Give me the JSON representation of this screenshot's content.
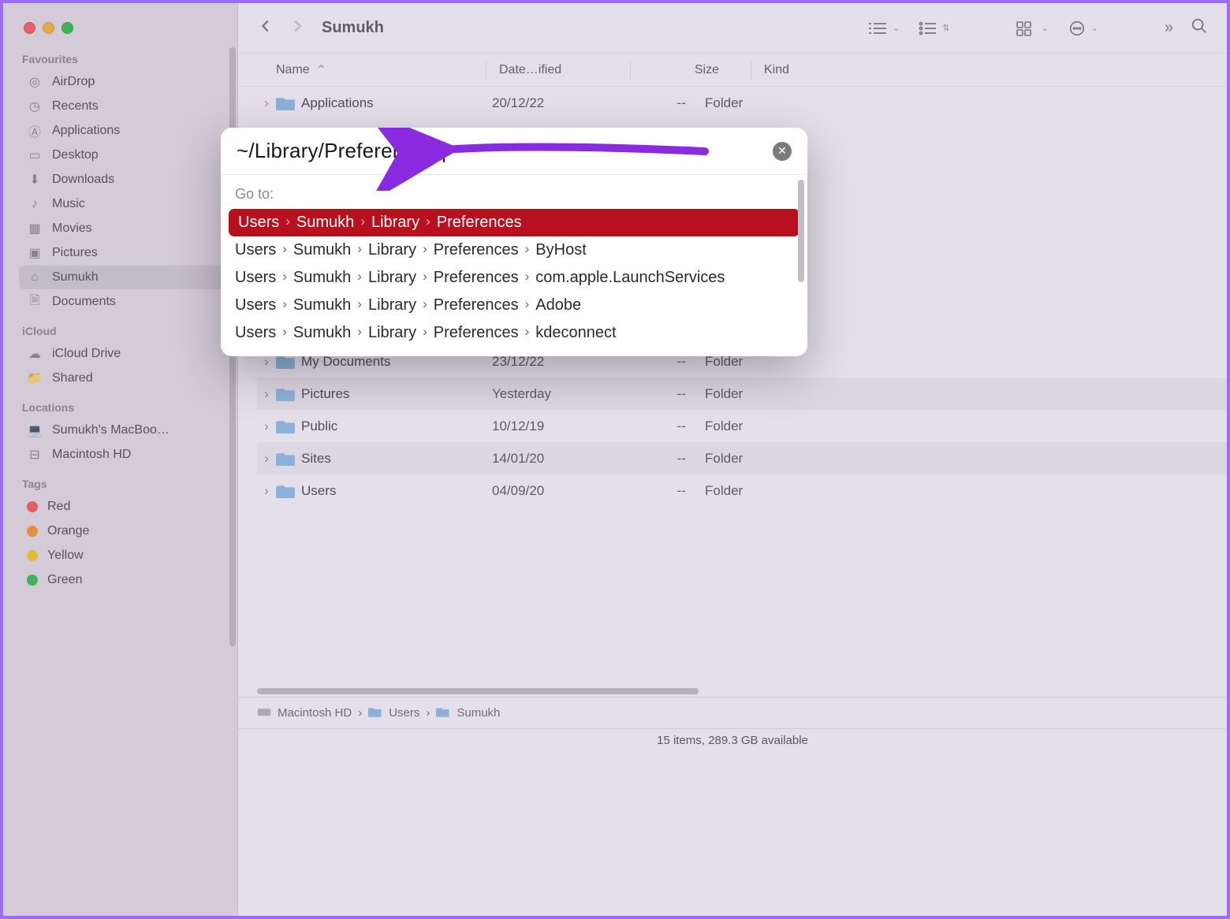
{
  "window": {
    "title": "Sumukh"
  },
  "sidebar": {
    "sections": {
      "favourites": {
        "label": "Favourites",
        "items": [
          "AirDrop",
          "Recents",
          "Applications",
          "Desktop",
          "Downloads",
          "Music",
          "Movies",
          "Pictures",
          "Sumukh",
          "Documents"
        ],
        "selected": "Sumukh"
      },
      "icloud": {
        "label": "iCloud",
        "items": [
          "iCloud Drive",
          "Shared"
        ]
      },
      "locations": {
        "label": "Locations",
        "items": [
          "Sumukh's MacBoo…",
          "Macintosh HD"
        ]
      },
      "tags": {
        "label": "Tags",
        "items": [
          {
            "label": "Red",
            "color": "#ff5b51"
          },
          {
            "label": "Orange",
            "color": "#ff9b1a"
          },
          {
            "label": "Yellow",
            "color": "#ffd21b"
          },
          {
            "label": "Green",
            "color": "#29c840"
          }
        ]
      }
    }
  },
  "columns": {
    "name": "Name",
    "date": "Date…ified",
    "size": "Size",
    "kind": "Kind"
  },
  "rows": [
    {
      "name": "Applications",
      "date": "20/12/22",
      "size": "--",
      "kind": "Folder"
    },
    {
      "name": "My Documents",
      "date": "23/12/22",
      "size": "--",
      "kind": "Folder"
    },
    {
      "name": "Pictures",
      "date": "Yesterday",
      "size": "--",
      "kind": "Folder"
    },
    {
      "name": "Public",
      "date": "10/12/19",
      "size": "--",
      "kind": "Folder"
    },
    {
      "name": "Sites",
      "date": "14/01/20",
      "size": "--",
      "kind": "Folder"
    },
    {
      "name": "Users",
      "date": "04/09/20",
      "size": "--",
      "kind": "Folder"
    }
  ],
  "pathbar": [
    "Macintosh HD",
    "Users",
    "Sumukh"
  ],
  "status": "15 items, 289.3 GB available",
  "goto_dialog": {
    "input": "~/Library/Preferences/",
    "label": "Go to:",
    "suggestions": [
      {
        "parts": [
          "Users",
          "Sumukh",
          "Library",
          "Preferences"
        ],
        "selected": true
      },
      {
        "parts": [
          "Users",
          "Sumukh",
          "Library",
          "Preferences",
          "ByHost"
        ],
        "selected": false
      },
      {
        "parts": [
          "Users",
          "Sumukh",
          "Library",
          "Preferences",
          "com.apple.LaunchServices"
        ],
        "selected": false
      },
      {
        "parts": [
          "Users",
          "Sumukh",
          "Library",
          "Preferences",
          "Adobe"
        ],
        "selected": false
      },
      {
        "parts": [
          "Users",
          "Sumukh",
          "Library",
          "Preferences",
          "kdeconnect"
        ],
        "selected": false
      }
    ]
  },
  "annotation": {
    "arrow_color": "#8a2be2"
  }
}
